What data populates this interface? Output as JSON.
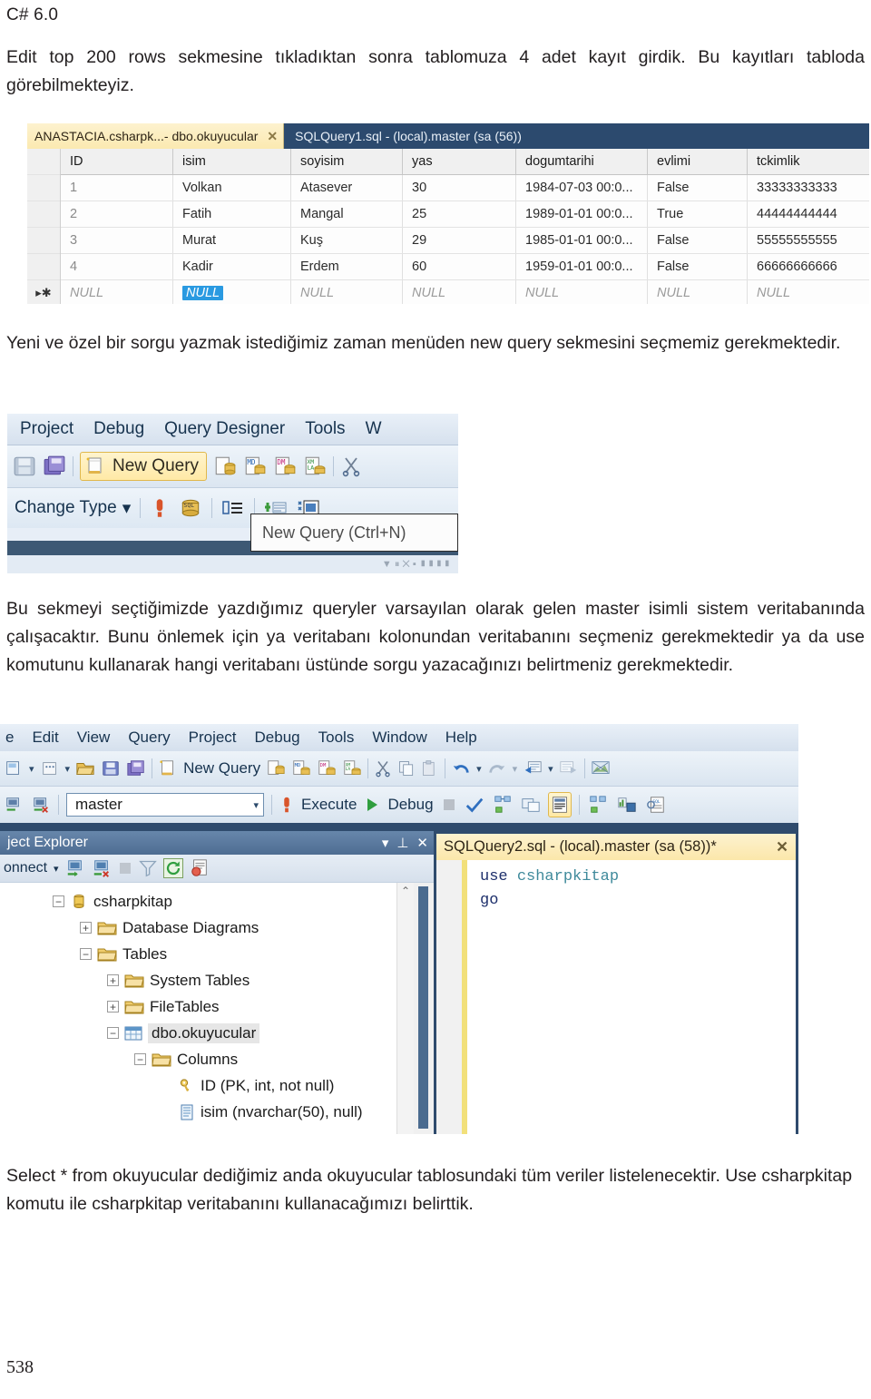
{
  "document": {
    "header": "C# 6.0",
    "page_number": "538",
    "paragraph_1": "Edit top 200 rows sekmesine tıkladıktan sonra tablomuza 4 adet kayıt girdik. Bu kayıtları tabloda görebilmekteyiz.",
    "paragraph_2": "Yeni ve özel bir sorgu yazmak istediğimiz zaman menüden new query sekmesini seçmemiz gerekmektedir.",
    "paragraph_3": "Bu sekmeyi seçtiğimizde yazdığımız queryler varsayılan olarak gelen master isimli sistem veritabanında çalışacaktır. Bunu önlemek için ya veritabanı kolonundan veritabanını seçmeniz gerekmektedir ya da use komutunu kullanarak hangi veritabanı üstünde sorgu yazacağınızı belirtmeniz gerekmektedir.",
    "paragraph_4": "Select * from okuyucular dediğimiz anda okuyucular tablosundaki tüm veriler listelenecektir. Use csharpkitap komutu ile csharpkitap veritabanını kullanacağımızı belirttik."
  },
  "screenshot_grid": {
    "tab_active": "ANASTACIA.csharpk...- dbo.okuyucular",
    "tab_close": "✕",
    "tab_inactive": "SQLQuery1.sql - (local).master (sa (56))",
    "columns": [
      "ID",
      "isim",
      "soyisim",
      "yas",
      "dogumtarihi",
      "evlimi",
      "tckimlik"
    ],
    "rows": [
      [
        "1",
        "Volkan",
        "Atasever",
        "30",
        "1984-07-03 00:0...",
        "False",
        "33333333333"
      ],
      [
        "2",
        "Fatih",
        "Mangal",
        "25",
        "1989-01-01 00:0...",
        "True",
        "44444444444"
      ],
      [
        "3",
        "Murat",
        "Kuş",
        "29",
        "1985-01-01 00:0...",
        "False",
        "55555555555"
      ],
      [
        "4",
        "Kadir",
        "Erdem",
        "60",
        "1959-01-01 00:0...",
        "False",
        "66666666666"
      ]
    ],
    "new_row": [
      "NULL",
      "NULL",
      "NULL",
      "NULL",
      "NULL",
      "NULL",
      "NULL"
    ],
    "new_row_marker": "▸✱",
    "selected_cell": "NULL",
    "selection_color": "#2a9ae1"
  },
  "screenshot_newquery": {
    "menus": [
      "Project",
      "Debug",
      "Query Designer",
      "Tools",
      "W"
    ],
    "new_query_button": "New Query",
    "change_type_button": "Change Type",
    "change_type_caret": "▾",
    "tooltip": "New Query (Ctrl+N)",
    "sql_icon_label": "SQL",
    "highlight_color": "#ffe9a6"
  },
  "screenshot_ssms": {
    "menus": [
      "e",
      "Edit",
      "View",
      "Query",
      "Project",
      "Debug",
      "Tools",
      "Window",
      "Help"
    ],
    "toolbar": {
      "new_query_button": "New Query"
    },
    "query_toolbar": {
      "database_value": "master",
      "database_caret": "▾",
      "execute_label": "Execute",
      "debug_label": "Debug"
    },
    "object_explorer": {
      "title": "ject Explorer",
      "title_controls": [
        "▾",
        "⊥",
        "✕"
      ],
      "connect_label": "onnect",
      "connect_caret": "▾",
      "tree": [
        {
          "indent": 1,
          "expander": "−",
          "icon": "database-icon",
          "label": "csharpkitap"
        },
        {
          "indent": 2,
          "expander": "+",
          "icon": "folder-icon",
          "label": "Database Diagrams"
        },
        {
          "indent": 2,
          "expander": "−",
          "icon": "folder-icon",
          "label": "Tables"
        },
        {
          "indent": 3,
          "expander": "+",
          "icon": "folder-icon",
          "label": "System Tables"
        },
        {
          "indent": 3,
          "expander": "+",
          "icon": "folder-icon",
          "label": "FileTables"
        },
        {
          "indent": 3,
          "expander": "−",
          "icon": "table-icon",
          "label": "dbo.okuyucular",
          "selected": true
        },
        {
          "indent": 4,
          "expander": "−",
          "icon": "folder-icon",
          "label": "Columns"
        },
        {
          "indent": 5,
          "expander": "",
          "icon": "key-icon",
          "label": "ID (PK, int, not null)"
        },
        {
          "indent": 5,
          "expander": "",
          "icon": "column-icon",
          "label": "isim (nvarchar(50), null)"
        }
      ],
      "scroll_up_arrow": "⌃"
    },
    "editor": {
      "tab_title": "SQLQuery2.sql - (local).master (sa (58))*",
      "tab_close": "✕",
      "code_line_1_keyword": "use",
      "code_line_1_value": "csharpkitap",
      "code_line_2": "go"
    }
  }
}
